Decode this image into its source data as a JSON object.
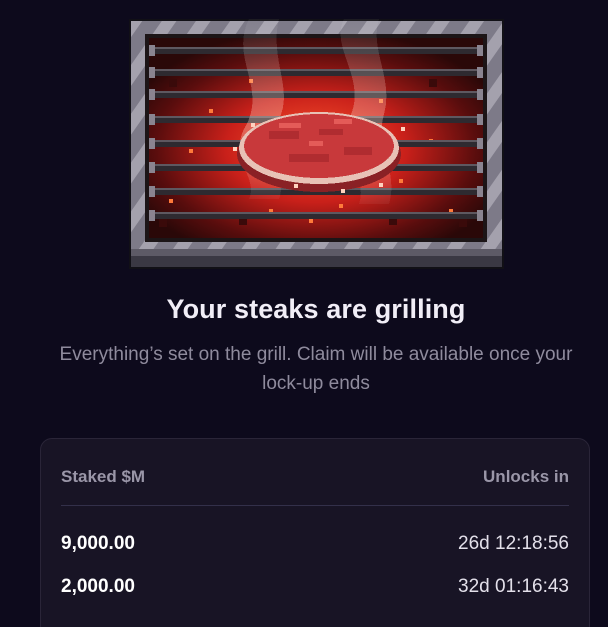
{
  "hero": {
    "title": "Your steaks are grilling",
    "subtitle": "Everything’s set on the grill. Claim will be available once your lock-up ends"
  },
  "stakes": {
    "columns": {
      "amount": "Staked $M",
      "unlock": "Unlocks in"
    },
    "rows": [
      {
        "amount": "9,000.00",
        "unlock": "26d 12:18:56"
      },
      {
        "amount": "2,000.00",
        "unlock": "32d 01:16:43"
      }
    ]
  },
  "colors": {
    "background": "#0d0a1c",
    "card": "#181425",
    "title": "#f1eef7",
    "muted": "#8f8b9d",
    "steak": "#c8393b",
    "embers": "#e0331f"
  },
  "icons": {
    "illustration": "grilling-steak-icon"
  }
}
